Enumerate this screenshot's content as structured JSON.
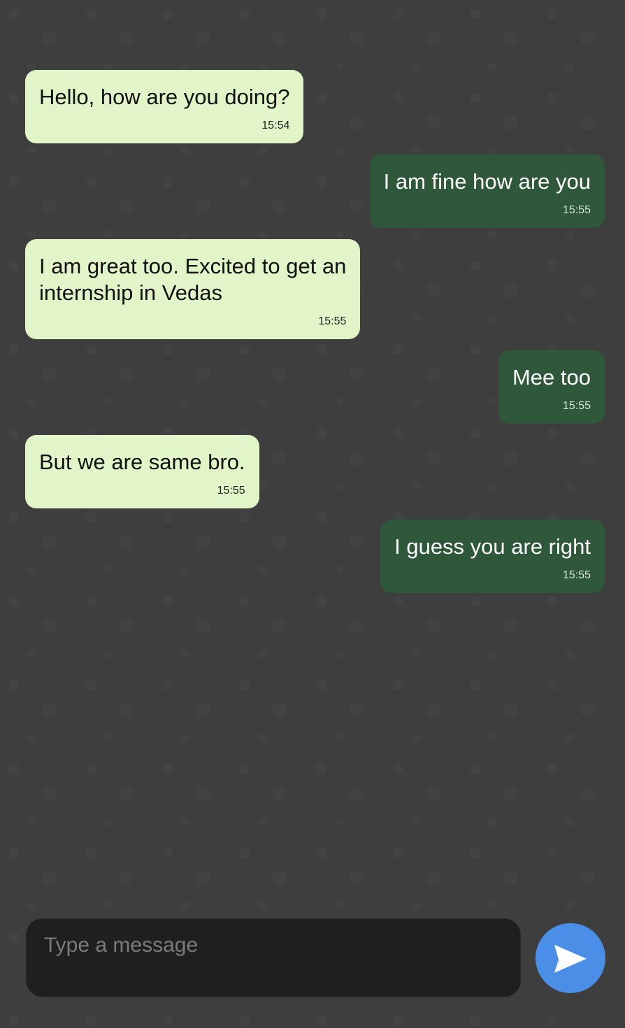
{
  "chat": {
    "messages": [
      {
        "direction": "received",
        "text": "Hello, how are you doing?",
        "time": "15:54"
      },
      {
        "direction": "sent",
        "text": "I am fine how are you",
        "time": "15:55"
      },
      {
        "direction": "received",
        "text": "I am great too. Excited to get an\ninternship in Vedas",
        "time": "15:55"
      },
      {
        "direction": "sent",
        "text": "Mee too",
        "time": "15:55"
      },
      {
        "direction": "received",
        "text": "But we are same bro.",
        "time": "15:55"
      },
      {
        "direction": "sent",
        "text": "I guess you are right",
        "time": "15:55"
      }
    ]
  },
  "composer": {
    "value": "",
    "placeholder": "Type a message",
    "send_icon": "send-icon"
  },
  "colors": {
    "background": "#3e3e3e",
    "received_bubble": "#e1f5c9",
    "sent_bubble": "#2f573a",
    "send_button": "#4a8ee8",
    "input_background": "#1f1f1f"
  }
}
